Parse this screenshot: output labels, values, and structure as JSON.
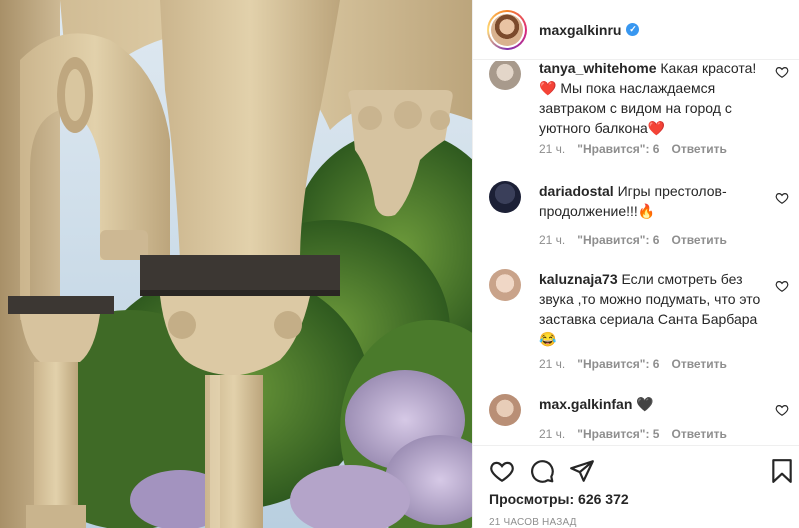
{
  "post": {
    "username": "maxgalkinru",
    "verified_badge": "✓",
    "views_label": "Просмотры: 626 372",
    "time_ago": "21 ЧАСОВ НАЗАД"
  },
  "comments": [
    {
      "author": "tanya_whitehome",
      "text": "Какая красота! ❤️ Мы пока наслаждаемся завтраком с видом на город с уютного балкона❤️",
      "time": "21 ч.",
      "likes": "\"Нравится\": 6",
      "reply": "Ответить"
    },
    {
      "author": "dariadostal",
      "text": "Игры престолов-продолжение!!!🔥",
      "time": "21 ч.",
      "likes": "\"Нравится\": 6",
      "reply": "Ответить"
    },
    {
      "author": "kaluznaja73",
      "text": "Если смотреть без звука ,то можно подумать, что это заставка сериала Санта Барбара 😂",
      "time": "21 ч.",
      "likes": "\"Нравится\": 6",
      "reply": "Ответить"
    },
    {
      "author": "max.galkinfan",
      "text": "🖤",
      "time": "21 ч.",
      "likes": "\"Нравится\": 5",
      "reply": "Ответить"
    }
  ],
  "icons": {
    "like": "heart-icon",
    "comment": "comment-icon",
    "share": "share-icon",
    "save": "bookmark-icon"
  },
  "colors": {
    "verified": "#3897f0",
    "text": "#262626",
    "muted": "#8e8e8e",
    "border": "#efefef"
  }
}
